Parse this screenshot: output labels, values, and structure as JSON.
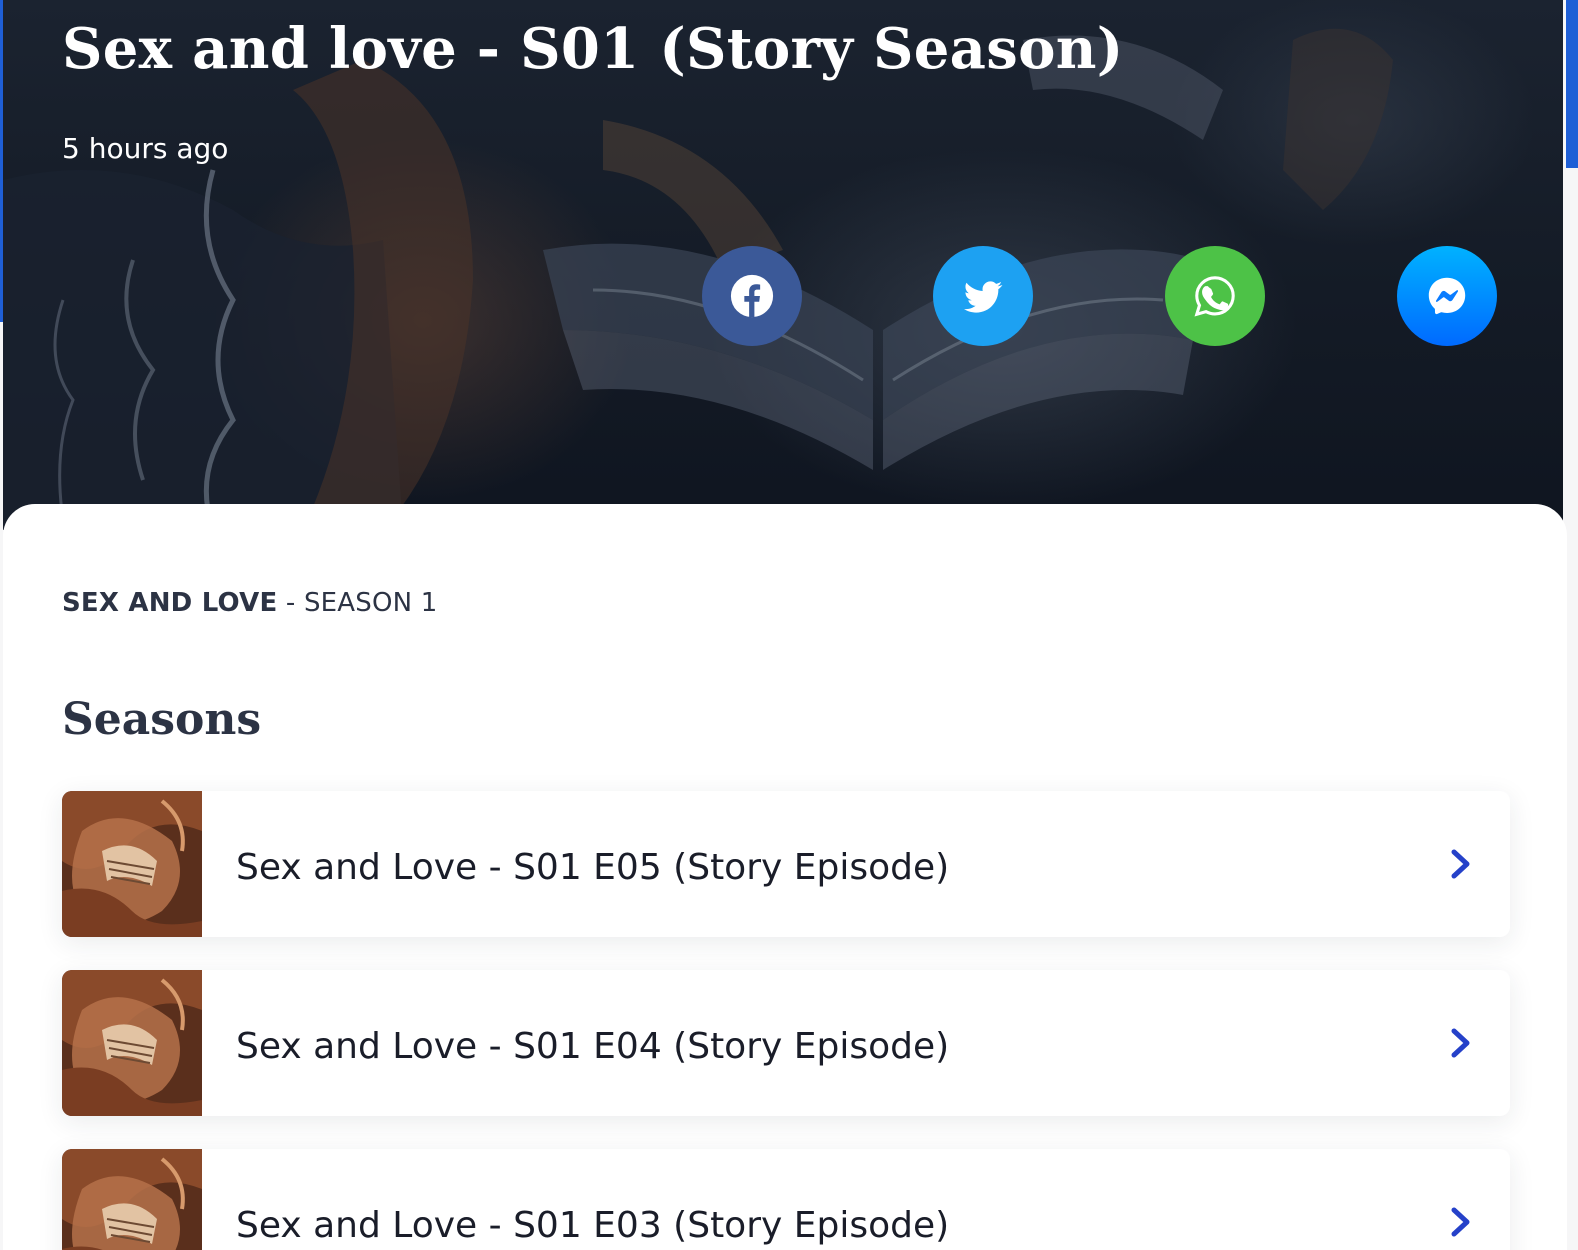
{
  "hero": {
    "title": "Sex and love - S01 (Story Season)",
    "posted": "5 hours ago"
  },
  "share": [
    {
      "name": "facebook",
      "icon": "facebook-icon",
      "color": "#3b5998"
    },
    {
      "name": "twitter",
      "icon": "twitter-icon",
      "color": "#1da1f2"
    },
    {
      "name": "whatsapp",
      "icon": "whatsapp-icon",
      "color": "#4dc247"
    },
    {
      "name": "messenger",
      "icon": "messenger-icon",
      "color": "#0a7cff"
    }
  ],
  "breadcrumb": {
    "show": "SEX AND LOVE",
    "separator": " - ",
    "season": "SEASON 1"
  },
  "section": {
    "heading": "Seasons"
  },
  "episodes": [
    {
      "label": "Sex and Love - S01 E05 (Story Episode)"
    },
    {
      "label": "Sex and Love - S01 E04 (Story Episode)"
    },
    {
      "label": "Sex and Love - S01 E03 (Story Episode)"
    }
  ],
  "colors": {
    "accent": "#1f5fd6",
    "chevron": "#2541c9",
    "text_dark": "#1a1d29",
    "heading": "#2c3344"
  }
}
